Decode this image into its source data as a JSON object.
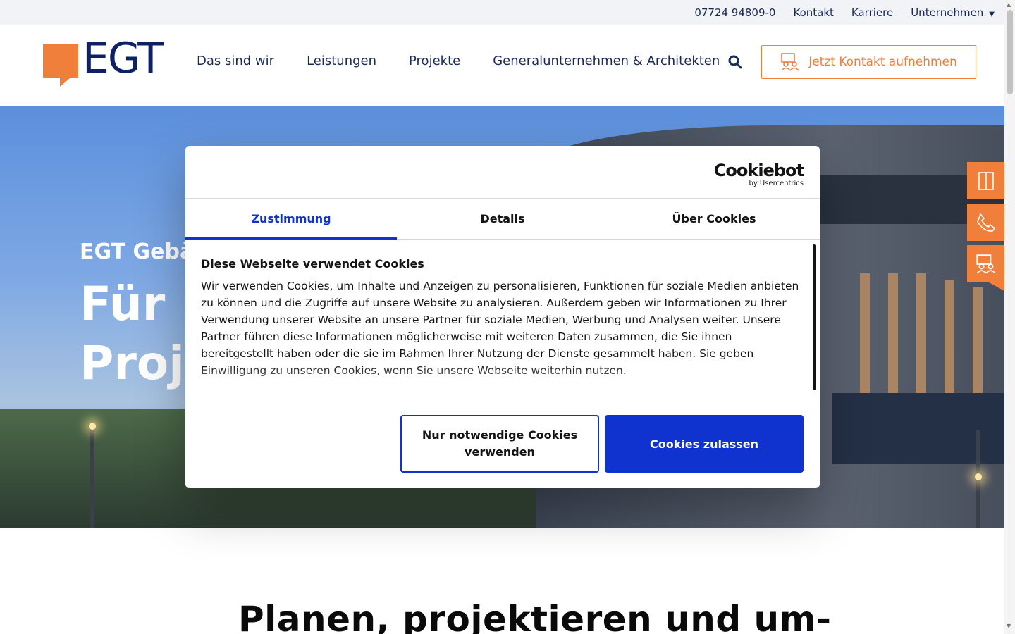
{
  "topbar": {
    "phone": "07724 94809-0",
    "links": [
      "Kontakt",
      "Karriere",
      "Unternehmen"
    ]
  },
  "header": {
    "logo_text": "EGT",
    "nav": [
      "Das sind wir",
      "Leistungen",
      "Projekte",
      "Generalunternehmen & Architekten"
    ],
    "cta_label": "Jetzt Kontakt aufnehmen"
  },
  "hero": {
    "subtitle": "EGT Gebäu",
    "title_line1": "Für I",
    "title_line2": "Proje"
  },
  "side_actions": [
    "door-icon",
    "phone-icon",
    "contact-person-icon"
  ],
  "section": {
    "heading": "Planen, projektieren und um-"
  },
  "cookie_dialog": {
    "brand": "Cookiebot",
    "brand_sub": "by Usercentrics",
    "tabs": [
      "Zustimmung",
      "Details",
      "Über Cookies"
    ],
    "active_tab": "Zustimmung",
    "heading": "Diese Webseite verwendet Cookies",
    "body": "Wir verwenden Cookies, um Inhalte und Anzeigen zu personalisieren, Funktionen für soziale Medien anbieten zu können und die Zugriffe auf unsere Website zu analysieren. Außerdem geben wir Informationen zu Ihrer Verwendung unserer Website an unsere Partner für soziale Medien, Werbung und Analysen weiter. Unsere Partner führen diese Informationen möglicherweise mit weiteren Daten zusammen, die Sie ihnen bereitgestellt haben oder die sie im Rahmen Ihrer Nutzung der Dienste gesammelt haben. Sie geben Einwilligung zu unseren Cookies, wenn Sie unsere Webseite weiterhin nutzen.",
    "btn_necessary": "Nur notwendige Cookies verwenden",
    "btn_allow": "Cookies zulassen"
  },
  "colors": {
    "accent_orange": "#f07f3c",
    "navy": "#0e2164",
    "cookie_blue": "#1032cf"
  }
}
